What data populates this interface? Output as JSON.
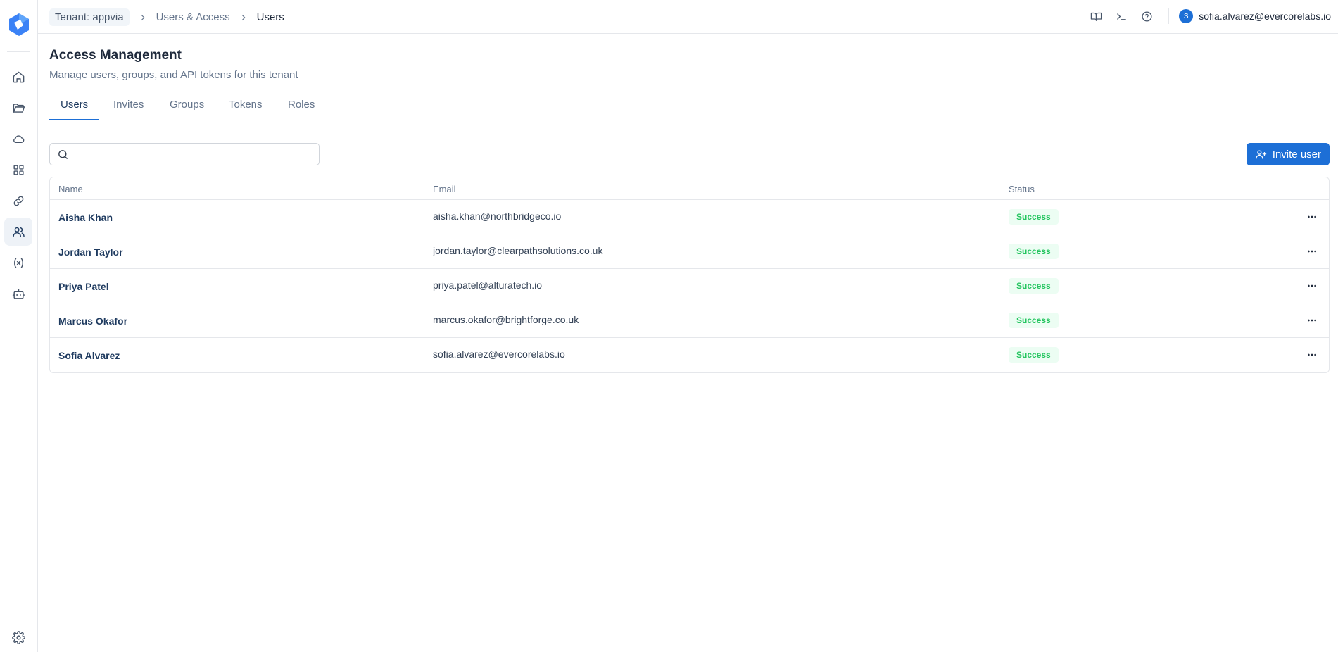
{
  "sidebar": {
    "logo": "app-logo",
    "items": [
      {
        "icon": "home-icon",
        "active": false
      },
      {
        "icon": "folder-icon",
        "active": false
      },
      {
        "icon": "cloud-icon",
        "active": false
      },
      {
        "icon": "grid-icon",
        "active": false
      },
      {
        "icon": "link-icon",
        "active": false
      },
      {
        "icon": "users-icon",
        "active": true
      },
      {
        "icon": "variable-icon",
        "active": false
      },
      {
        "icon": "bot-icon",
        "active": false
      }
    ],
    "bottom_icon": "gear-icon"
  },
  "breadcrumb": {
    "tenant": "Tenant: appvia",
    "section": "Users & Access",
    "current": "Users"
  },
  "header": {
    "icons": [
      "book-icon",
      "terminal-icon",
      "help-icon"
    ],
    "user_initial": "S",
    "user_email": "sofia.alvarez@evercorelabs.io"
  },
  "page": {
    "title": "Access Management",
    "subtitle": "Manage users, groups, and API tokens for this tenant"
  },
  "tabs": [
    {
      "label": "Users",
      "active": true
    },
    {
      "label": "Invites",
      "active": false
    },
    {
      "label": "Groups",
      "active": false
    },
    {
      "label": "Tokens",
      "active": false
    },
    {
      "label": "Roles",
      "active": false
    }
  ],
  "search": {
    "value": "",
    "placeholder": ""
  },
  "invite_button": {
    "label": "Invite user"
  },
  "table": {
    "columns": [
      "Name",
      "Email",
      "Status"
    ],
    "rows": [
      {
        "name": "Aisha Khan",
        "email": "aisha.khan@northbridgeco.io",
        "status": "Success"
      },
      {
        "name": "Jordan Taylor",
        "email": "jordan.taylor@clearpathsolutions.co.uk",
        "status": "Success"
      },
      {
        "name": "Priya Patel",
        "email": "priya.patel@alturatech.io",
        "status": "Success"
      },
      {
        "name": "Marcus Okafor",
        "email": "marcus.okafor@brightforge.co.uk",
        "status": "Success"
      },
      {
        "name": "Sofia Alvarez",
        "email": "sofia.alvarez@evercorelabs.io",
        "status": "Success"
      }
    ]
  },
  "colors": {
    "accent": "#1d6fd6",
    "success_text": "#22c55e",
    "success_bg": "#ecfdf3",
    "border": "#e5e7eb"
  }
}
